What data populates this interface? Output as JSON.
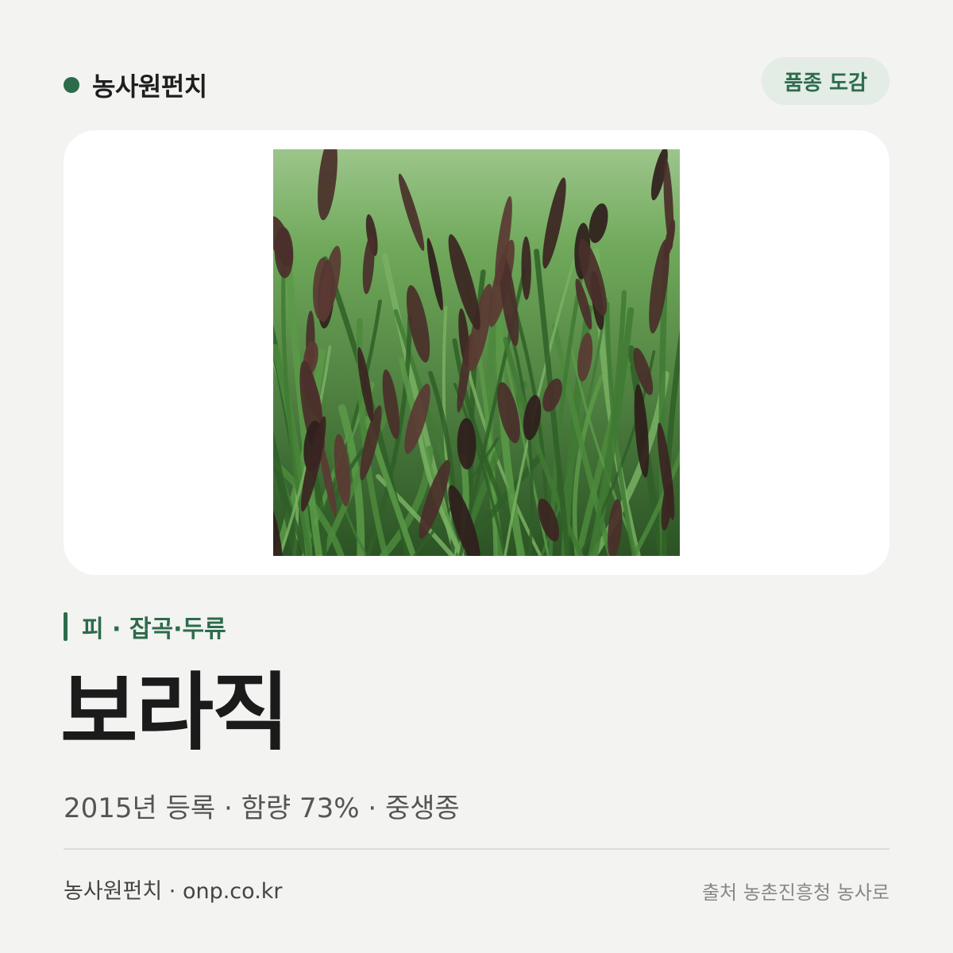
{
  "header": {
    "brand_name": "농사원펀치",
    "badge_label": "품종 도감"
  },
  "photo": {
    "description_name": "millet-field-photo",
    "colors": {
      "grass_dark": "#2f5a28",
      "grass_light": "#6fa85a",
      "panicle": "#4a2f2a",
      "background": "#8bb77a"
    }
  },
  "category": {
    "label": "피 · 잡곡·두류"
  },
  "variety": {
    "name": "보라직"
  },
  "meta": {
    "text": "2015년 등록 · 함량 73% · 중생종"
  },
  "footer": {
    "left": "농사원펀치 · onp.co.kr",
    "right": "출처 농촌진흥청 농사로"
  },
  "colors": {
    "accent": "#2c6b4b",
    "badge_bg": "#e3ece5",
    "page_bg": "#f3f3f1"
  }
}
